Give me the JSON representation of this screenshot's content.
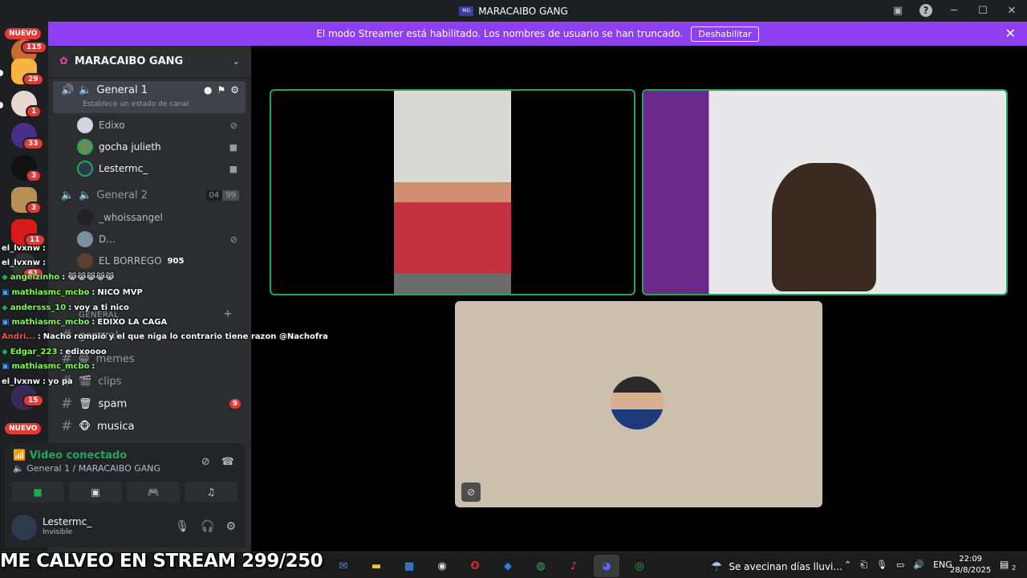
{
  "window": {
    "title": "MARACAIBO GANG"
  },
  "banner": {
    "text": "El modo Streamer está habilitado. Los nombres de usuario se han truncado.",
    "button": "Deshabilitar"
  },
  "rail": {
    "nuevo_top": "NUEVO",
    "nuevo_bottom": "NUEVO",
    "badges": [
      "115",
      "29",
      "1",
      "33",
      "3",
      "3",
      "3",
      "11",
      "61",
      "15"
    ]
  },
  "server": {
    "name": "MARACAIBO GANG"
  },
  "voice_channels": [
    {
      "name": "General 1",
      "status": "Establece un estado de canal",
      "users": [
        {
          "name": "Edixo"
        },
        {
          "name": "gocha julieth"
        },
        {
          "name": "Lestermc_"
        }
      ]
    },
    {
      "name": "General 2",
      "count_left": "04",
      "count_right": "99",
      "users": [
        {
          "name": "_whoissangel"
        },
        {
          "name": "D..."
        },
        {
          "name": "EL BORREGO",
          "extra": "905"
        }
      ]
    }
  ],
  "category": {
    "label": "GENERAL"
  },
  "text_channels": [
    {
      "name": "general"
    },
    {
      "name": "memes"
    },
    {
      "name": "clips"
    },
    {
      "name": "spam",
      "badge": "9"
    },
    {
      "name": "musica"
    }
  ],
  "voice_panel": {
    "status": "Video conectado",
    "location": "General 1 / MARACAIBO GANG"
  },
  "user": {
    "name": "Lestermc_",
    "status": "Invisible"
  },
  "chat": [
    {
      "user": "el_lvxnw",
      "msg": ""
    },
    {
      "user": "el_lvxnw",
      "msg": ""
    },
    {
      "user": "angelzinho",
      "msg": "😹😹😹😹😹"
    },
    {
      "user": "mathiasmc_mcbo",
      "msg": "NICO MVP"
    },
    {
      "user": "andersss_10",
      "msg": "voy a ti nico"
    },
    {
      "user": "mathiasmc_mcbo",
      "msg": "EDIXO LA CAGA"
    },
    {
      "user": "Andrí...",
      "msg": "Nacho rompió y el que niga lo contrario tiene razon @Nachofra"
    },
    {
      "user": "Edgar_223",
      "msg": "edixoooo"
    },
    {
      "user": "mathiasmc_mcbo",
      "msg": ""
    },
    {
      "user": "el_lvxnw",
      "msg": "yo pa"
    }
  ],
  "overlay": {
    "text": "ME CALVEO EN STREAM 299/250"
  },
  "taskbar": {
    "weather": "Se avecinan días lluvi...",
    "lang": "ENG",
    "time": "22:09",
    "date": "28/8/2025",
    "notifications": "2"
  }
}
